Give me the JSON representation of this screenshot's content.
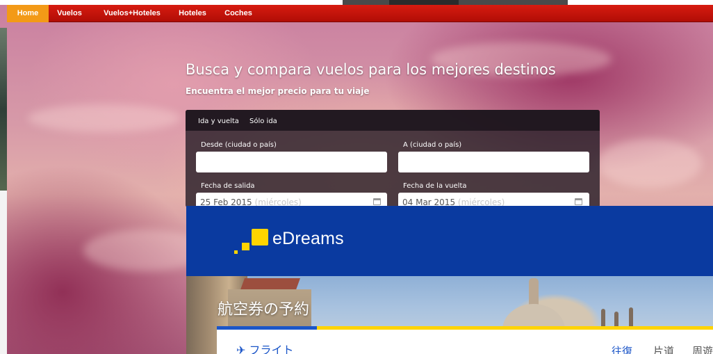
{
  "nav": {
    "items": [
      {
        "label": "Home"
      },
      {
        "label": "Vuelos"
      },
      {
        "label": "Vuelos+Hoteles"
      },
      {
        "label": "Hoteles"
      },
      {
        "label": "Coches"
      }
    ]
  },
  "hero": {
    "title": "Busca y compara vuelos para los mejores destinos",
    "subtitle": "Encuentra el mejor precio para tu viaje"
  },
  "search": {
    "tabs": [
      {
        "label": "Ida y vuelta"
      },
      {
        "label": "Sólo ida"
      }
    ],
    "from_label": "Desde  (ciudad o país)",
    "to_label": "A  (ciudad o país)",
    "depart_label": "Fecha de salida",
    "return_label": "Fecha de la vuelta",
    "depart_value": "25 Feb 2015",
    "depart_weekday": "(miércoles)",
    "return_value": "04 Mar 2015",
    "return_weekday": "(miércoles)"
  },
  "edreams": {
    "logo_text": "eDreams",
    "page_title": "航空券の予約",
    "section": "フライト",
    "trip_options": [
      {
        "label": "往復"
      },
      {
        "label": "片道"
      },
      {
        "label": "周遊"
      }
    ],
    "colors": {
      "header": "#0a3aa0",
      "accent": "#ffd400",
      "link": "#1c56c8"
    }
  },
  "colors": {
    "nav_red": "#c4140b",
    "nav_active": "#f39a17"
  }
}
